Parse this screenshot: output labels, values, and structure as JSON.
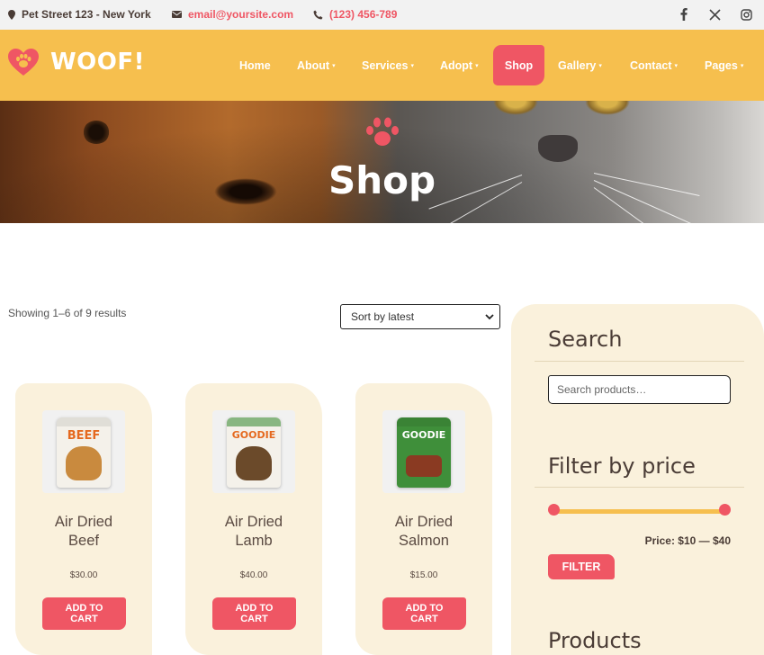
{
  "topbar": {
    "address": "Pet Street 123 - New York",
    "email": "email@yoursite.com",
    "phone": "(123) 456-789",
    "social": [
      {
        "icon": "facebook-icon"
      },
      {
        "icon": "x-twitter-icon"
      },
      {
        "icon": "instagram-icon"
      }
    ]
  },
  "header": {
    "logo_text": "WOOF!",
    "nav": [
      {
        "label": "Home",
        "has_caret": false
      },
      {
        "label": "About",
        "has_caret": true
      },
      {
        "label": "Services",
        "has_caret": true
      },
      {
        "label": "Adopt",
        "has_caret": true
      },
      {
        "label": "Shop",
        "active": true
      },
      {
        "label": "Gallery",
        "has_caret": true
      },
      {
        "label": "Contact",
        "has_caret": true
      },
      {
        "label": "Pages",
        "has_caret": true
      }
    ],
    "caret": "▾"
  },
  "hero": {
    "title": "Shop",
    "icon": "paw-icon"
  },
  "shop": {
    "result_count": "Showing 1–6 of 9 results",
    "sort_selected": "Sort by latest",
    "products": [
      {
        "name_line1": "Air Dried",
        "name_line2": "Beef",
        "price": "$30.00",
        "button": "ADD TO CART",
        "button_l1": "ADD TO",
        "button_l2": "CART",
        "pkg_label": "BEEF",
        "pkg_color": "#f4f1ea",
        "label_color": "#e5691f",
        "pet_color": "#c98a3e"
      },
      {
        "name_line1": "Air Dried",
        "name_line2": "Lamb",
        "price": "$40.00",
        "button": "ADD TO CART",
        "button_l1": "ADD TO",
        "button_l2": "CART",
        "pkg_label": "GOODIE",
        "pkg_color": "#f4f1ea",
        "label_color": "#e5691f",
        "pet_color": "#6b4a2a"
      },
      {
        "name_line1": "Air Dried",
        "name_line2": "Salmon",
        "price": "$15.00",
        "button": "ADD TO CART",
        "button_l1": "ADD TO",
        "button_l2": "CART",
        "pkg_label": "GOODIE",
        "pkg_color": "#3f8f3a",
        "label_color": "#ffffff",
        "pet_color": "#8a3a22"
      }
    ]
  },
  "sidebar": {
    "search_title": "Search",
    "search_placeholder": "Search products…",
    "filter_title": "Filter by price",
    "price_label": "Price: $10 — $40",
    "filter_button": "FILTER",
    "products_title": "Products"
  },
  "colors": {
    "accent": "#ef5664",
    "header_bg": "#f6bf4e",
    "card_bg": "#faf1dc",
    "text": "#5a4a42"
  }
}
